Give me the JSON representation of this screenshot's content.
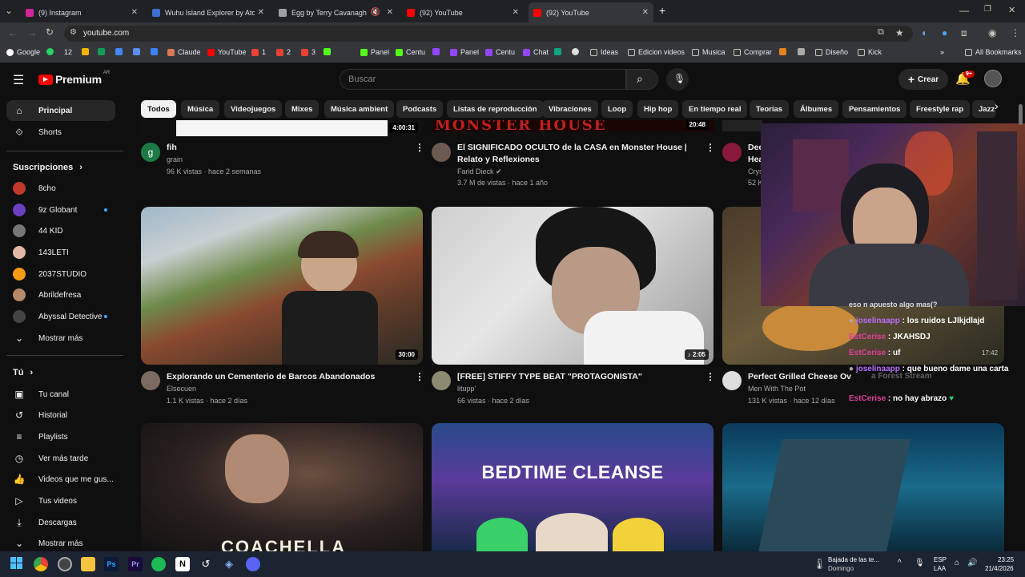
{
  "browser": {
    "tabs": [
      {
        "label": "(9) Instagram",
        "color": "#d6249f"
      },
      {
        "label": "Wuhu Island Explorer by Atomic",
        "color": "#3b6fd0"
      },
      {
        "label": "Egg by Terry Cavanagh",
        "color": "#9aa0a6"
      },
      {
        "label": "(92) YouTube",
        "color": "#ff0000"
      },
      {
        "label": "(92) YouTube",
        "color": "#ff0000"
      }
    ],
    "new_tab": "+",
    "url": "youtube.com",
    "bookmarks": [
      "Google",
      "12",
      "Claude",
      "YouTube",
      "1",
      "2",
      "3",
      "Panel",
      "Centu",
      "Panel",
      "Centu",
      "Chat",
      "Ideas",
      "Edicion videos",
      "Musica",
      "Comprar",
      "Diseño",
      "Kick",
      "All Bookmarks"
    ]
  },
  "youtube": {
    "logo": "Premium",
    "region": "AR",
    "search_placeholder": "Buscar",
    "create_label": "Crear",
    "notif_badge": "9+",
    "chips": [
      "Todos",
      "Música",
      "Videojuegos",
      "Mixes",
      "Música ambient",
      "Podcasts",
      "Listas de reproducción",
      "Vibraciones",
      "Loop",
      "Hip hop",
      "En tiempo real",
      "Teorías",
      "Álbumes",
      "Pensamientos",
      "Freestyle rap",
      "Jazz"
    ]
  },
  "sidebar": {
    "main": [
      {
        "label": "Principal",
        "icon": "home-icon"
      },
      {
        "label": "Shorts",
        "icon": "shorts-icon"
      }
    ],
    "subs_header": "Suscripciones",
    "subs": [
      {
        "label": "8cho",
        "color": "#c0392b",
        "live": false
      },
      {
        "label": "9z Globant",
        "color": "#6a3fc0",
        "live": true
      },
      {
        "label": "44 KID",
        "color": "#777",
        "live": false
      },
      {
        "label": "143LETI",
        "color": "#e3b7a7",
        "live": false
      },
      {
        "label": "2037STUDIO",
        "color": "#f39c12",
        "live": false
      },
      {
        "label": "Abrildefresa",
        "color": "#b48a6a",
        "live": false
      },
      {
        "label": "Abyssal Detective",
        "color": "#444",
        "live": true
      }
    ],
    "more_label": "Mostrar más",
    "you_header": "Tú",
    "you": [
      {
        "label": "Tu canal",
        "icon": "channel-icon"
      },
      {
        "label": "Historial",
        "icon": "history-icon"
      },
      {
        "label": "Playlists",
        "icon": "playlists-icon"
      },
      {
        "label": "Ver más tarde",
        "icon": "watch-later-icon"
      },
      {
        "label": "Videos que me gus...",
        "icon": "liked-icon"
      },
      {
        "label": "Tus videos",
        "icon": "your-videos-icon"
      },
      {
        "label": "Descargas",
        "icon": "downloads-icon"
      },
      {
        "label": "Mostrar más",
        "icon": "chevron-down-icon"
      }
    ]
  },
  "videos": {
    "row1": [
      {
        "title": "fih",
        "channel": "grain",
        "meta": "96 K vistas · hace 2 semanas",
        "duration": "4:00:31"
      },
      {
        "title": "El SIGNIFICADO OCULTO de la CASA en Monster House | Relato y Reflexiones",
        "channel": "Farid Dieck",
        "meta": "3.7 M de vistas · hace 1 año",
        "duration": "20:48"
      },
      {
        "title": "Dee",
        "title2": "Hea",
        "channel": "Crys",
        "meta": "52 K"
      }
    ],
    "row2": [
      {
        "title": "Explorando un Cementerio de Barcos Abandonados",
        "channel": "Elsecuen",
        "meta": "1.1 K vistas · hace 2 días",
        "duration": "30:00"
      },
      {
        "title": "[FREE] STIFFY TYPE BEAT \"PROTAGONISTA\"",
        "channel": "litupp'",
        "meta": "66 vistas · hace 2 días",
        "duration": "2:05"
      },
      {
        "title": "Perfect Grilled Cheese Ov",
        "channel": "Men With The Pot",
        "meta": "131 K vistas · hace 12 días"
      }
    ],
    "row3": [
      {
        "overlay": "COACHELLA"
      },
      {
        "overlay": "BEDTIME CLEANSE"
      },
      {
        "overlay": ""
      }
    ]
  },
  "stream_chat": [
    {
      "name": "",
      "text": "eso n apuesto algo mas(?"
    },
    {
      "name": "joselinaapp",
      "text": ": los ruidos LJlkjdlajd"
    },
    {
      "name": "EstCerise",
      "text": ": JKAHSDJ"
    },
    {
      "name": "EstCerise",
      "text": ": uf"
    },
    {
      "name": "joselinaapp",
      "text": ": que bueno dame una carta"
    },
    {
      "name": "EstCerise",
      "text": ": no hay abrazo"
    }
  ],
  "chat_overlay": {
    "time": "17:42",
    "extra": "a Forest Stream"
  },
  "taskbar": {
    "weather_line1": "Bajada de las te...",
    "weather_line2": "Domingo",
    "lang1": "ESP",
    "lang2": "LAA",
    "time": "23:25",
    "date": "21/4/2026"
  }
}
